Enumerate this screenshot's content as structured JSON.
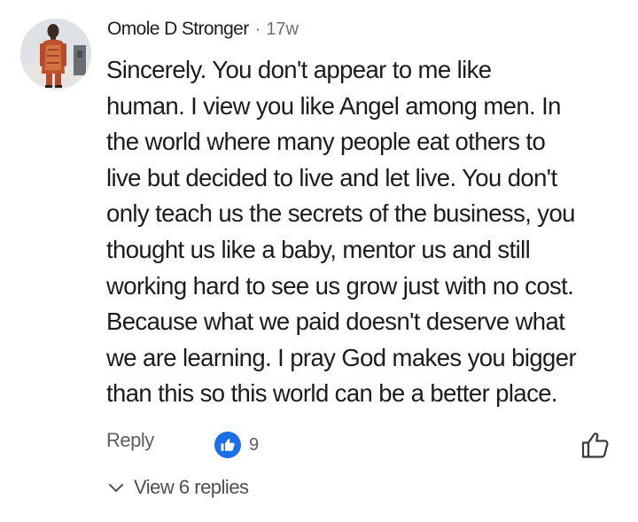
{
  "comment": {
    "author": "Omole D Stronger",
    "separator": "·",
    "time": "17w",
    "avatar_icon": "profile-photo",
    "text_lines": [
      "Sincerely. You don't appear to me like",
      "human. I view you like Angel among men. In",
      "the world where many people eat others to",
      "live but decided to live and let live. You don't",
      "only teach us the secrets of the business, you",
      "thought us like a baby, mentor us and still",
      "working hard to see us grow just with no cost.",
      "Because what we paid doesn't deserve what",
      "we are learning. I pray God makes you bigger",
      "than this so this world can be a better place."
    ]
  },
  "actions": {
    "reply_label": "Reply",
    "like_count": "9",
    "reaction_icon": "thumbs-up-icon",
    "like_button_icon": "thumbs-up-outline-icon",
    "view_replies_label": "View 6 replies",
    "view_replies_icon": "chevron-down-icon"
  },
  "colors": {
    "text": "#1c1c1c",
    "meta": "#6f6f6f",
    "like_badge": "#1a6fe8"
  }
}
